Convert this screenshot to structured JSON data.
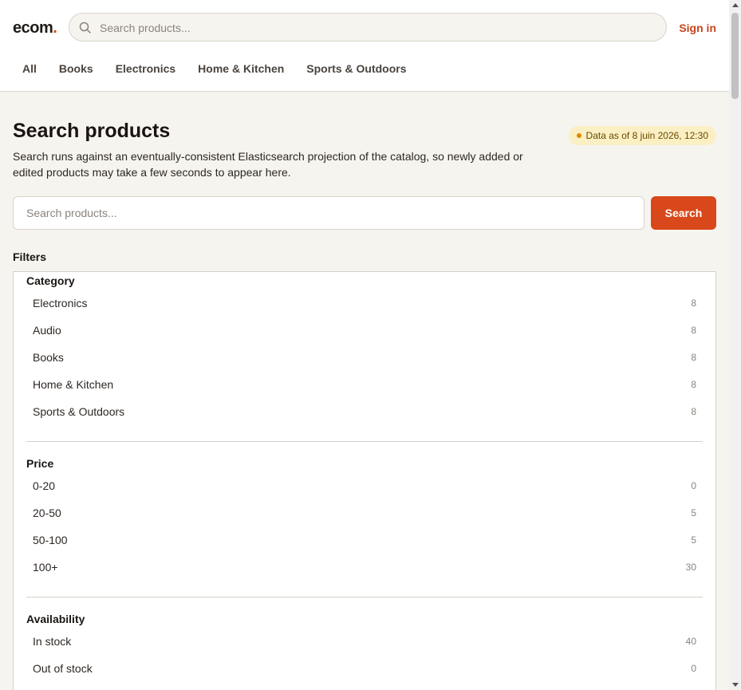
{
  "header": {
    "logo_text": "ecom",
    "logo_dot": ".",
    "search_placeholder": "Search products...",
    "signin_label": "Sign in",
    "nav": [
      "All",
      "Books",
      "Electronics",
      "Home & Kitchen",
      "Sports & Outdoors"
    ]
  },
  "main": {
    "title": "Search products",
    "description": "Search runs against an eventually-consistent Elasticsearch projection of the catalog, so newly added or edited products may take a few seconds to appear here.",
    "freshness_badge": "Data as of 8 juin 2026, 12:30",
    "search_placeholder": "Search products...",
    "search_button": "Search",
    "filters_label": "Filters"
  },
  "filters": {
    "category": {
      "title": "Category",
      "items": [
        {
          "label": "Electronics",
          "count": "8"
        },
        {
          "label": "Audio",
          "count": "8"
        },
        {
          "label": "Books",
          "count": "8"
        },
        {
          "label": "Home & Kitchen",
          "count": "8"
        },
        {
          "label": "Sports & Outdoors",
          "count": "8"
        }
      ]
    },
    "price": {
      "title": "Price",
      "items": [
        {
          "label": "0-20",
          "count": "0"
        },
        {
          "label": "20-50",
          "count": "5"
        },
        {
          "label": "50-100",
          "count": "5"
        },
        {
          "label": "100+",
          "count": "30"
        }
      ]
    },
    "availability": {
      "title": "Availability",
      "items": [
        {
          "label": "In stock",
          "count": "40"
        },
        {
          "label": "Out of stock",
          "count": "0"
        }
      ]
    }
  },
  "colors": {
    "accent": "#d9481a",
    "badge_bg": "#fbefc4",
    "page_bg": "#f6f4ef"
  },
  "icons": {
    "search": "search-icon"
  }
}
